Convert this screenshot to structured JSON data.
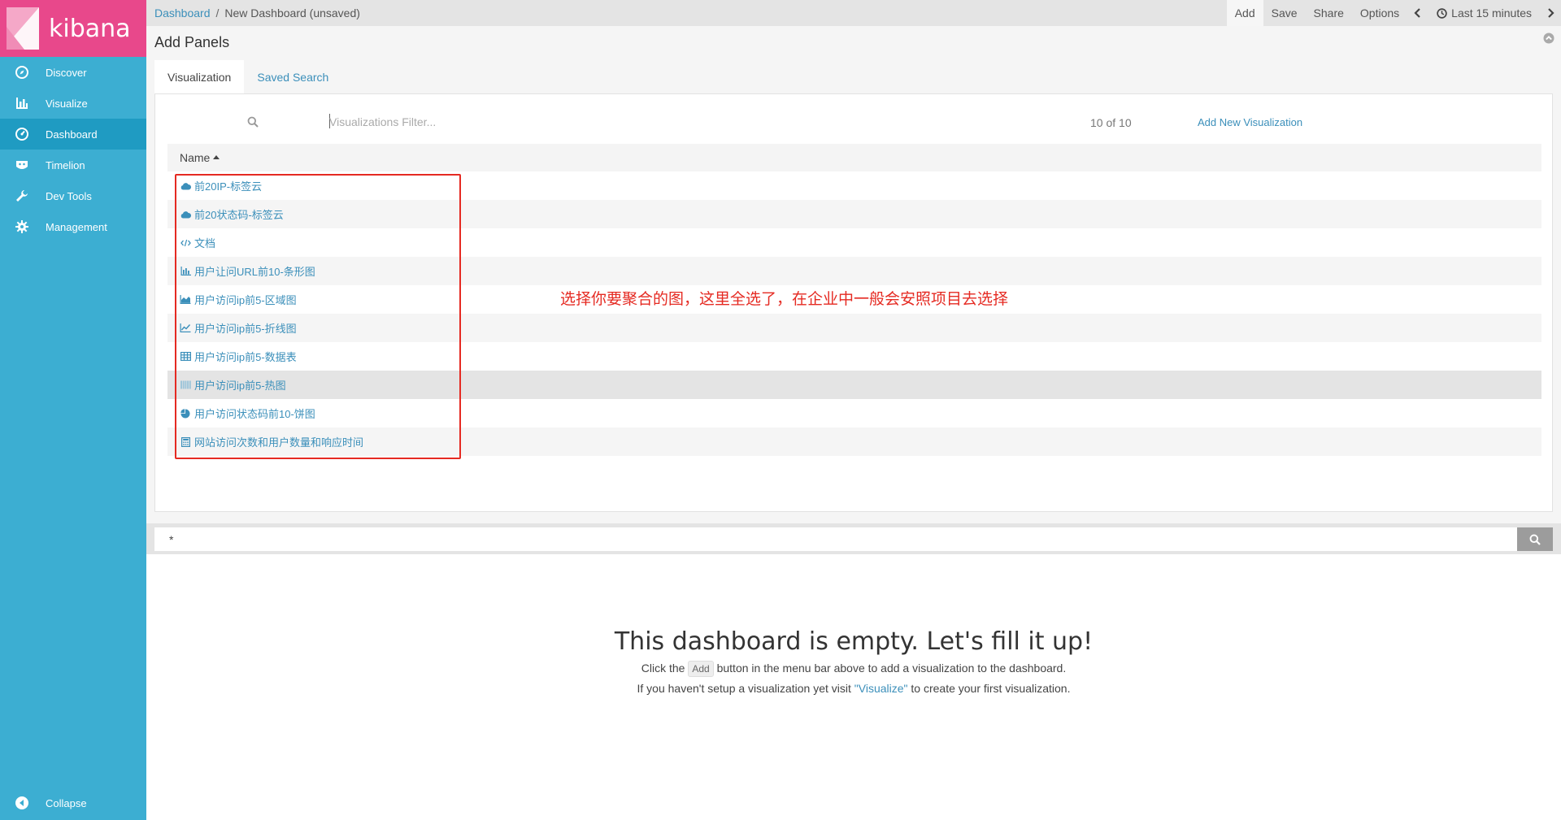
{
  "app": {
    "logo_text": "kibana"
  },
  "nav": {
    "items": [
      {
        "label": "Discover",
        "icon": "compass-icon"
      },
      {
        "label": "Visualize",
        "icon": "bar-chart-icon"
      },
      {
        "label": "Dashboard",
        "icon": "dashboard-icon",
        "active": true
      },
      {
        "label": "Timelion",
        "icon": "timelion-icon"
      },
      {
        "label": "Dev Tools",
        "icon": "wrench-icon"
      },
      {
        "label": "Management",
        "icon": "gear-icon"
      }
    ],
    "collapse_label": "Collapse"
  },
  "topbar": {
    "breadcrumb_root": "Dashboard",
    "breadcrumb_sep": "/",
    "breadcrumb_current": "New Dashboard (unsaved)",
    "menu": {
      "add": "Add",
      "save": "Save",
      "share": "Share",
      "options": "Options"
    },
    "time_label": "Last 15 minutes"
  },
  "add_panels": {
    "title": "Add Panels",
    "tabs": {
      "visualization": "Visualization",
      "saved_search": "Saved Search"
    },
    "filter_placeholder": "Visualizations Filter...",
    "count": "10 of 10",
    "add_new": "Add New Visualization",
    "column_name": "Name",
    "items": [
      {
        "label": "前20IP-标签云",
        "icon": "cloud-icon"
      },
      {
        "label": "前20状态码-标签云",
        "icon": "cloud-icon"
      },
      {
        "label": "文档",
        "icon": "code-icon"
      },
      {
        "label": "用户让问URL前10-条形图",
        "icon": "bar-chart-icon"
      },
      {
        "label": "用户访问ip前5-区域图",
        "icon": "area-chart-icon"
      },
      {
        "label": "用户访问ip前5-折线图",
        "icon": "line-chart-icon"
      },
      {
        "label": "用户访问ip前5-数据表",
        "icon": "table-icon"
      },
      {
        "label": "用户访问ip前5-热图",
        "icon": "heatmap-icon"
      },
      {
        "label": "用户访问状态码前10-饼图",
        "icon": "pie-chart-icon"
      },
      {
        "label": "网站访问次数和用户数量和响应时间",
        "icon": "calculator-icon"
      }
    ],
    "annotation": "选择你要聚合的图，这里全选了，在企业中一般会安照项目去选择"
  },
  "query": {
    "value": "*"
  },
  "empty_state": {
    "title": "This dashboard is empty. Let's fill it up!",
    "line1_pre": "Click the",
    "line1_kbd": "Add",
    "line1_post": "button in the menu bar above to add a visualization to the dashboard.",
    "line2_pre": "If you haven't setup a visualization yet visit",
    "line2_link": "\"Visualize\"",
    "line2_post": "to create your first visualization."
  },
  "colors": {
    "sidebar": "#3caed2",
    "sidebar_active": "#1f9bc2",
    "logo_bg": "#e8488b",
    "link": "#3b8fba",
    "annotation_red": "#e52a22"
  }
}
